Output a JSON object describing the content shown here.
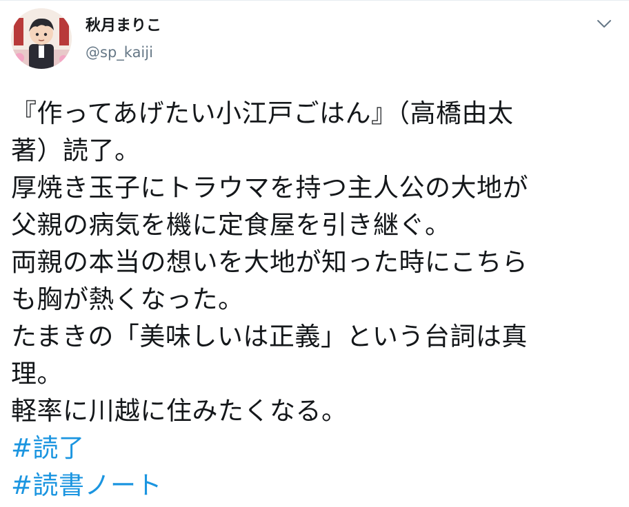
{
  "tweet": {
    "author": {
      "display_name": "秋月まりこ",
      "handle": "@sp_kaiji",
      "avatar_icon": "user-avatar-icon"
    },
    "menu_icon": "chevron-down-icon",
    "text_lines": [
      "『作ってあげたい小江戸ごはん』（高橋由太",
      "著）読了。",
      "厚焼き玉子にトラウマを持つ主人公の大地が",
      "父親の病気を機に定食屋を引き継ぐ。",
      "両親の本当の想いを大地が知った時にこちら",
      "も胸が熱くなった。",
      "たまきの「美味しいは正義」という台詞は真",
      "理。",
      "軽率に川越に住みたくなる。"
    ],
    "hashtags": [
      "#読了",
      "#読書ノート"
    ],
    "colors": {
      "text": "#14171a",
      "secondary": "#657786",
      "link": "#1b95e0"
    }
  }
}
